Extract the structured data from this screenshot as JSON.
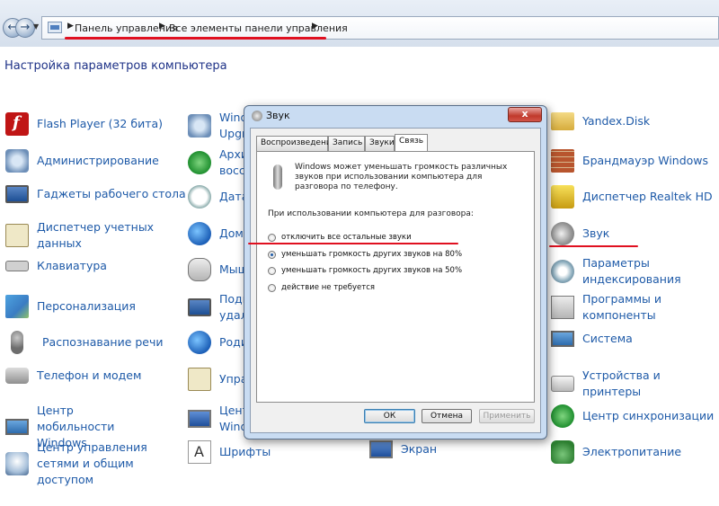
{
  "breadcrumb": {
    "items": [
      "Панель управления",
      "Все элементы панели управления"
    ]
  },
  "page_title": "Настройка параметров компьютера",
  "columns": {
    "col1": [
      {
        "label": "Flash Player (32 бита)",
        "icon": "flash-icon"
      },
      {
        "label": "Администрирование",
        "icon": "admin-tools-icon"
      },
      {
        "label": "Гаджеты рабочего стола",
        "icon": "gadgets-icon"
      },
      {
        "label": "Диспетчер учетных данных",
        "icon": "credential-manager-icon"
      },
      {
        "label": "Клавиатура",
        "icon": "keyboard-icon"
      },
      {
        "label": "Персонализация",
        "icon": "personalization-icon"
      },
      {
        "label": "Распознавание речи",
        "icon": "microphone-icon"
      },
      {
        "label": "Телефон и модем",
        "icon": "phone-modem-icon"
      },
      {
        "label": "Центр мобильности Windows",
        "icon": "mobility-center-icon"
      },
      {
        "label": "Центр управления сетями и общим доступом",
        "icon": "network-center-icon"
      }
    ],
    "col2": [
      {
        "label": "Wind\nUpgr",
        "icon": "windows-upgrade-icon"
      },
      {
        "label": "Архи\nвосст",
        "icon": "backup-icon"
      },
      {
        "label": "Дата",
        "icon": "date-time-icon"
      },
      {
        "label": "Дома",
        "icon": "homegroup-icon"
      },
      {
        "label": "Мыш",
        "icon": "mouse-icon"
      },
      {
        "label": "Подк\nудале",
        "icon": "remote-connection-icon"
      },
      {
        "label": "Роди",
        "icon": "parental-controls-icon"
      },
      {
        "label": "Упра",
        "icon": "credentials-icon"
      },
      {
        "label": "Цент\nWind",
        "icon": "windows-center-icon"
      },
      {
        "label": "Шрифты",
        "icon": "fonts-icon"
      }
    ],
    "col3_visible": [
      {
        "label": "Экран",
        "icon": "display-icon"
      }
    ],
    "col4": [
      {
        "label": "Yandex.Disk",
        "icon": "folder-icon"
      },
      {
        "label": "Брандмауэр Windows",
        "icon": "firewall-icon"
      },
      {
        "label": "Диспетчер Realtek HD",
        "icon": "realtek-icon"
      },
      {
        "label": "Звук",
        "icon": "speaker-icon"
      },
      {
        "label": "Параметры индексирования",
        "icon": "indexing-icon"
      },
      {
        "label": "Программы и компоненты",
        "icon": "programs-icon"
      },
      {
        "label": "Система",
        "icon": "system-icon"
      },
      {
        "label": "Устройства и принтеры",
        "icon": "printer-icon"
      },
      {
        "label": "Центр синхронизации",
        "icon": "sync-center-icon"
      },
      {
        "label": "Электропитание",
        "icon": "power-icon"
      }
    ]
  },
  "dialog": {
    "title": "Звук",
    "close": "x",
    "tabs": [
      "Воспроизведение",
      "Запись",
      "Звуки",
      "Связь"
    ],
    "active_tab": "Связь",
    "description": "Windows может уменьшать громкость различных звуков при использовании компьютера для разговора по телефону.",
    "question": "При использовании компьютера для разговора:",
    "options": [
      {
        "label": "отключить все остальные звуки",
        "checked": false
      },
      {
        "label": "уменьшать громкость других звуков на 80%",
        "checked": true
      },
      {
        "label": "уменьшать громкость других звуков на 50%",
        "checked": false
      },
      {
        "label": "действие не требуется",
        "checked": false
      }
    ],
    "buttons": {
      "ok": "ОК",
      "cancel": "Отмена",
      "apply": "Применить"
    }
  },
  "colors": {
    "link": "#1e5aa8",
    "title": "#1e3287",
    "annotation": "#e01020"
  }
}
